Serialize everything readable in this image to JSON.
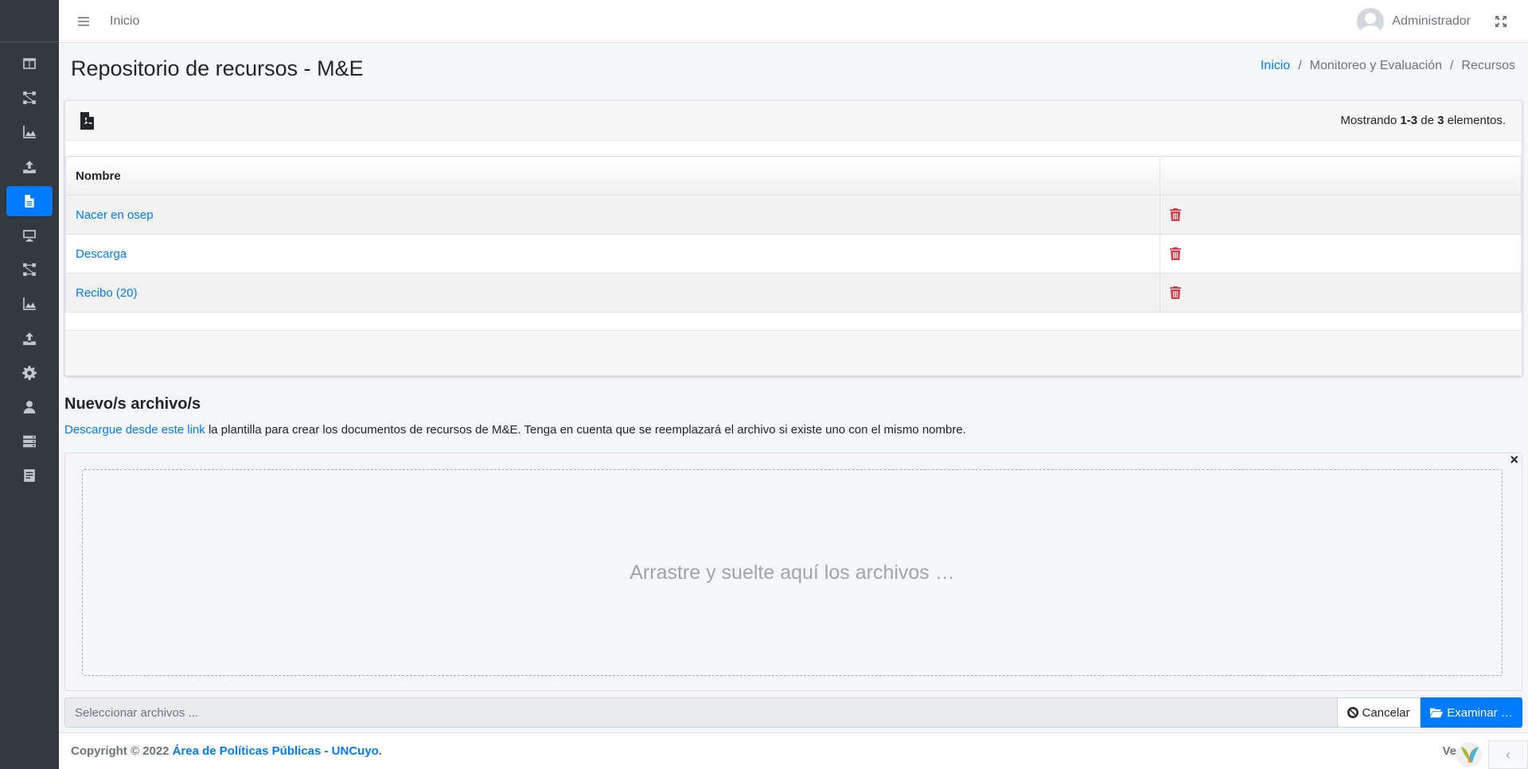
{
  "navbar": {
    "home_link": "Inicio",
    "user_name": "Administrador"
  },
  "sidebar": {
    "items": [
      {
        "icon": "columns-icon"
      },
      {
        "icon": "project-diagram-icon"
      },
      {
        "icon": "chart-area-icon"
      },
      {
        "icon": "upload-icon"
      },
      {
        "icon": "file-icon",
        "active": true
      },
      {
        "icon": "desktop-icon"
      },
      {
        "icon": "project-diagram-icon"
      },
      {
        "icon": "chart-area-icon"
      },
      {
        "icon": "upload-icon"
      },
      {
        "icon": "gear-icon"
      },
      {
        "icon": "user-icon"
      },
      {
        "icon": "server-icon"
      },
      {
        "icon": "file-alt-icon"
      }
    ]
  },
  "header": {
    "title": "Repositorio de recursos - M&E",
    "breadcrumb": [
      "Inicio",
      "Monitoreo y Evaluación",
      "Recursos"
    ]
  },
  "grid": {
    "summary_prefix": "Mostrando",
    "summary_range": "1-3",
    "summary_of": "de",
    "summary_total": "3",
    "summary_suffix": "elementos.",
    "column_name": "Nombre",
    "rows": [
      {
        "name": "Nacer en osep"
      },
      {
        "name": "Descarga"
      },
      {
        "name": "Recibo (20)"
      }
    ]
  },
  "upload": {
    "title": "Nuevo/s archivo/s",
    "template_link": "Descargue desde este link",
    "help_text": "la plantilla para crear los documentos de recursos de M&E. Tenga en cuenta que se reemplazará el archivo si existe uno con el mismo nombre.",
    "close": "×",
    "drop_text": "Arrastre y suelte aquí los archivos …",
    "caption_placeholder": "Seleccionar archivos ...",
    "cancel_label": "Cancelar",
    "browse_label": "Examinar …"
  },
  "footer": {
    "copyright": "Copyright © 2022",
    "org_link": "Área de Políticas Públicas - UNCuyo",
    "period": ".",
    "version": "Ve"
  },
  "colors": {
    "primary": "#007bff",
    "danger": "#dc3545",
    "sidebar": "#343a40"
  }
}
